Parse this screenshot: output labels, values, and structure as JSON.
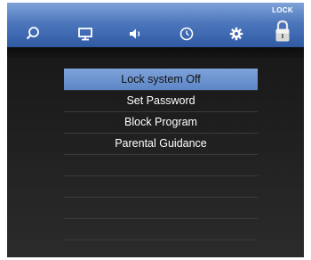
{
  "topbar": {
    "icons": [
      {
        "name": "search-icon"
      },
      {
        "name": "monitor-icon"
      },
      {
        "name": "speaker-icon"
      },
      {
        "name": "clock-icon"
      },
      {
        "name": "gear-icon"
      },
      {
        "name": "lock-icon"
      }
    ],
    "active_tab_label": "LOCK"
  },
  "menu": {
    "items": [
      {
        "label": "Lock system Off",
        "selected": true
      },
      {
        "label": "Set Password",
        "selected": false
      },
      {
        "label": "Block Program",
        "selected": false
      },
      {
        "label": "Parental Guidance",
        "selected": false
      }
    ]
  },
  "colors": {
    "topbar": "#4d77bd",
    "selected_item": "#6f96d2",
    "background": "#1c1c1c"
  }
}
